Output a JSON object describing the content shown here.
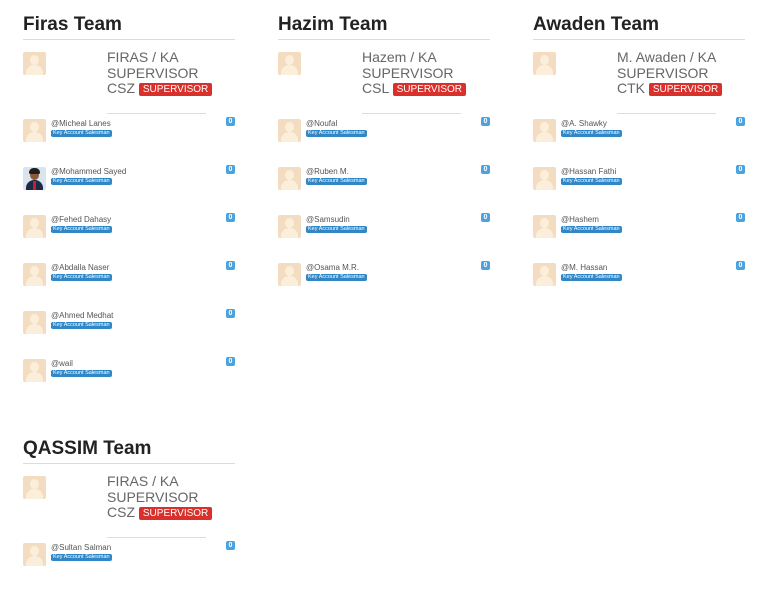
{
  "role_label": "Key Account Salesman",
  "teams": [
    {
      "title": "Firas Team",
      "supervisor": {
        "line1": "FIRAS / KA",
        "line2": "SUPERVISOR",
        "line3": "CSZ",
        "badge": "SUPERVISOR"
      },
      "members": [
        {
          "name": "@Micheal Lanes",
          "count": "0"
        },
        {
          "name": "@Mohammed Sayed",
          "count": "0"
        },
        {
          "name": "@Fehed Dahasy",
          "count": "0"
        },
        {
          "name": "@Abdalla Naser",
          "count": "0"
        },
        {
          "name": "@Ahmed Medhat",
          "count": "0"
        },
        {
          "name": "@wail",
          "count": "0"
        }
      ]
    },
    {
      "title": "Hazim Team",
      "supervisor": {
        "line1": "Hazem / KA",
        "line2": "SUPERVISOR",
        "line3": "CSL",
        "badge": "SUPERVISOR"
      },
      "members": [
        {
          "name": "@Noufal",
          "count": "0"
        },
        {
          "name": "@Ruben M.",
          "count": "0"
        },
        {
          "name": "@Samsudin",
          "count": "0"
        },
        {
          "name": "@Osama M.R.",
          "count": "0"
        }
      ]
    },
    {
      "title": "Awaden Team",
      "supervisor": {
        "line1": "M. Awaden / KA",
        "line2": "SUPERVISOR",
        "line3": "CTK",
        "badge": "SUPERVISOR"
      },
      "members": [
        {
          "name": "@A. Shawky",
          "count": "0"
        },
        {
          "name": "@Hassan Fathi",
          "count": "0"
        },
        {
          "name": "@Hashem",
          "count": "0"
        },
        {
          "name": "@M. Hassan",
          "count": "0"
        }
      ]
    },
    {
      "title": "QASSIM Team",
      "supervisor": {
        "line1": "FIRAS / KA",
        "line2": "SUPERVISOR",
        "line3": "CSZ",
        "badge": "SUPERVISOR"
      },
      "members": [
        {
          "name": "@Sultan Salman",
          "count": "0"
        }
      ]
    }
  ]
}
